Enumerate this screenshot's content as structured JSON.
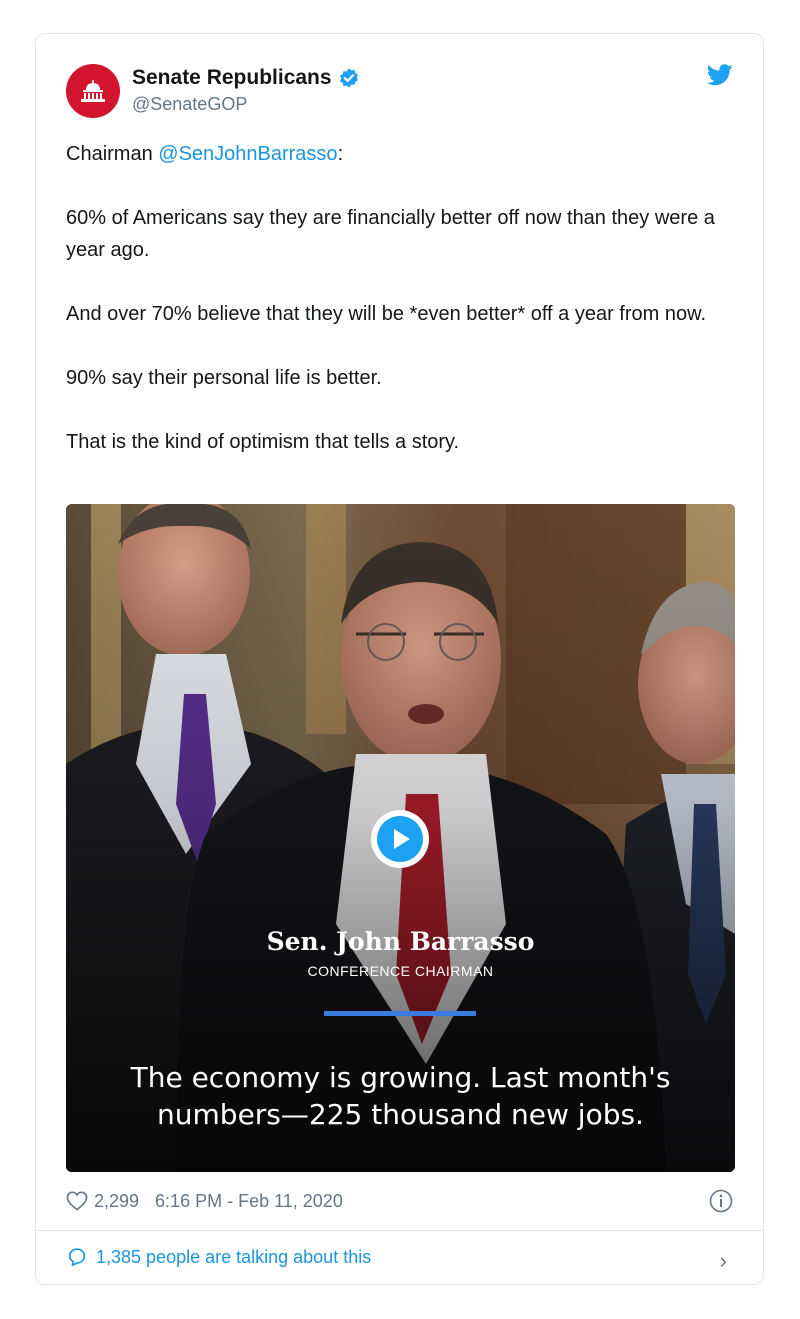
{
  "account": {
    "name": "Senate Republicans",
    "handle": "@SenateGOP"
  },
  "tweet": {
    "prefix": "Chairman ",
    "mention": "@SenJohnBarrasso",
    "suffix": ":",
    "paragraphs": [
      "60% of Americans say they are financially better off now than they were a year ago.",
      "And over 70% believe that they will be *even better* off a year from now.",
      "90% say their personal life is better.",
      "That is the kind of optimism that tells a story."
    ]
  },
  "video": {
    "lower_third_name": "Sen. John Barrasso",
    "lower_third_title": "CONFERENCE CHAIRMAN",
    "caption_line1": "The economy is growing. Last month's",
    "caption_line2": "numbers—225 thousand new jobs."
  },
  "meta": {
    "likes": "2,299",
    "timestamp": "6:16 PM - Feb 11, 2020"
  },
  "footer": {
    "conversation": "1,385 people are talking about this"
  },
  "colors": {
    "brand_red": "#d3142e",
    "twitter_blue": "#1da1f2",
    "link_blue": "#1b95e0"
  },
  "icons": [
    "capitol-icon",
    "verified-badge-icon",
    "twitter-bird-icon",
    "play-icon",
    "heart-icon",
    "info-icon",
    "speech-bubble-icon",
    "chevron-right-icon"
  ]
}
